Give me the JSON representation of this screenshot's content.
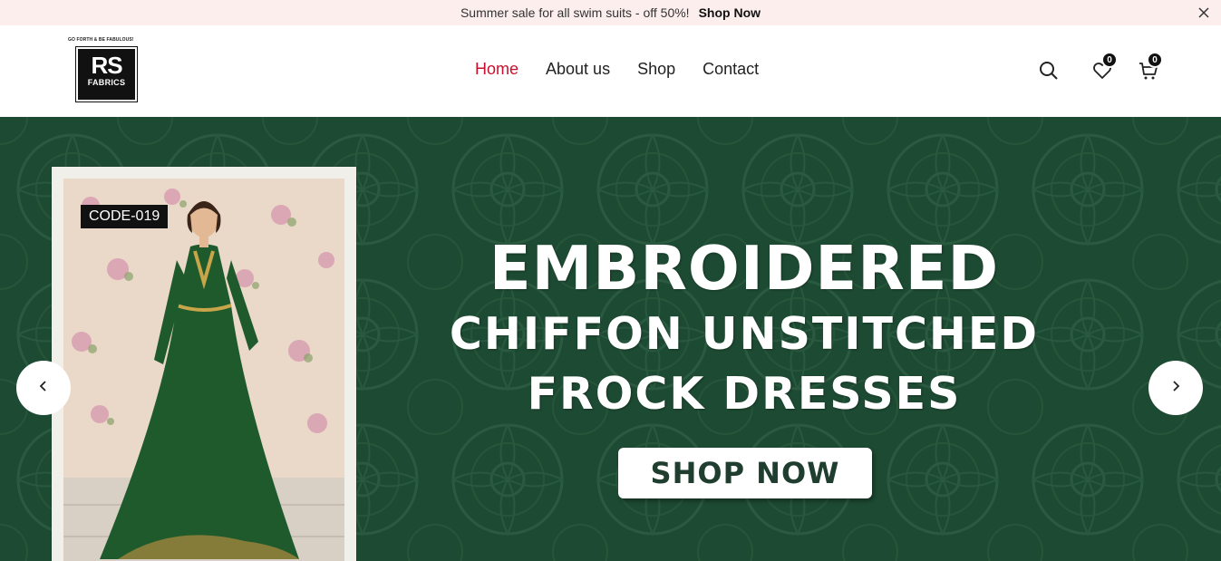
{
  "announcement": {
    "message": "Summer sale for all swim suits - off 50%!",
    "link_label": "Shop Now"
  },
  "logo": {
    "tagline": "GO FORTH & BE FABULOUS!",
    "main": "RS",
    "sub": "FABRICS"
  },
  "nav": {
    "items": [
      {
        "label": "Home",
        "active": true
      },
      {
        "label": "About us",
        "active": false
      },
      {
        "label": "Shop",
        "active": false
      },
      {
        "label": "Contact",
        "active": false
      }
    ]
  },
  "header_icons": {
    "search": "search-icon",
    "wishlist": "heart-icon",
    "wishlist_count": "0",
    "cart": "cart-icon",
    "cart_count": "0"
  },
  "hero": {
    "product_code": "CODE-019",
    "headline_line1": "EMBROIDERED",
    "headline_line2": "CHIFFON UNSTITCHED",
    "headline_line3": "FROCK DRESSES",
    "cta_label": "SHOP NOW",
    "prev_icon": "chevron-left-icon",
    "next_icon": "chevron-right-icon"
  },
  "colors": {
    "accent": "#c8102e",
    "hero_bg": "#1d4a32",
    "announce_bg": "#fdeeee"
  }
}
